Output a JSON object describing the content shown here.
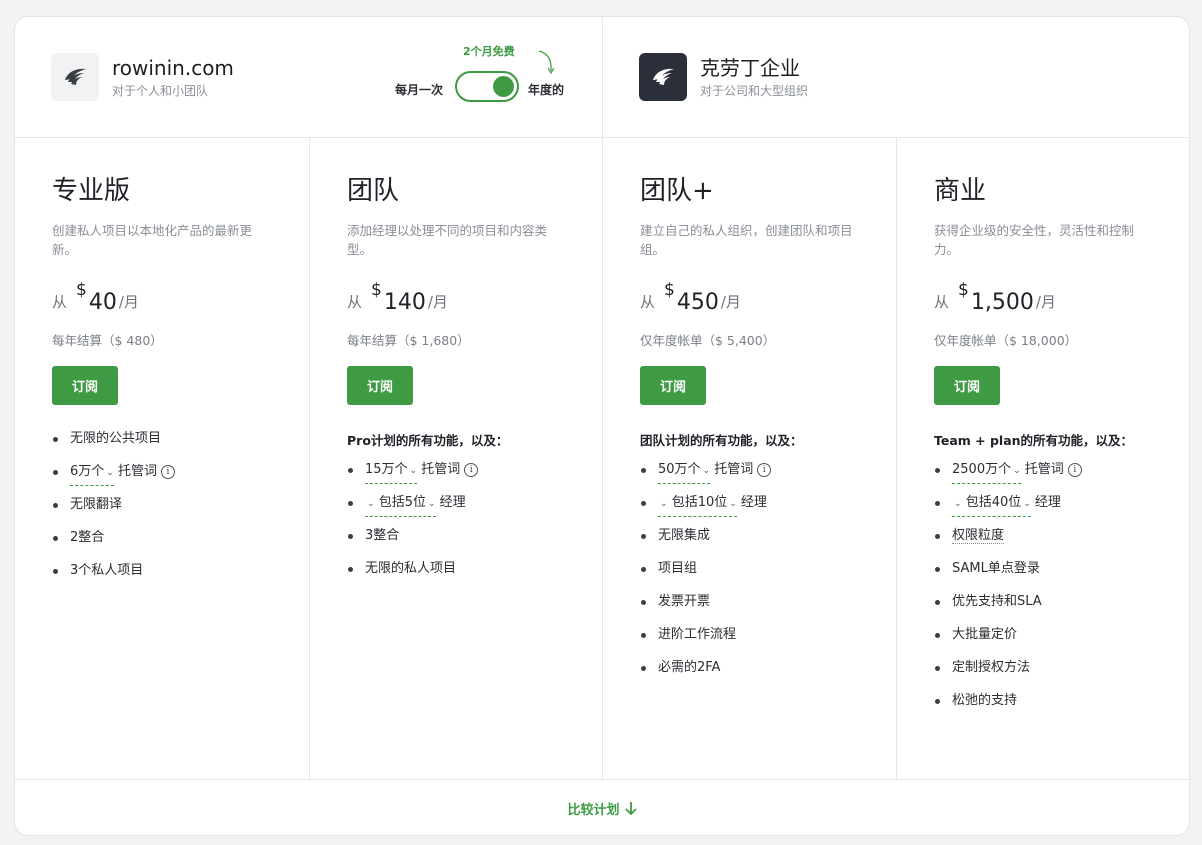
{
  "header": {
    "left_brand": {
      "name": "rowinin.com",
      "subtitle": "对于个人和小团队"
    },
    "right_brand": {
      "name": "克劳丁企业",
      "subtitle": "对于公司和大型组织"
    },
    "billing_toggle": {
      "promo": "2个月免费",
      "monthly_label": "每月一次",
      "annual_label": "年度的",
      "state": "annual"
    }
  },
  "plans": [
    {
      "name": "专业版",
      "description": "创建私人项目以本地化产品的最新更新。",
      "from": "从",
      "currency": "$",
      "amount": "40",
      "per": "/月",
      "billing": "每年结算（$ 480）",
      "button": "订阅",
      "features_heading": "",
      "features": [
        "无限的公共项目",
        "6万个",
        "托管词",
        "无限翻译",
        "2整合",
        "3个私人项目"
      ]
    },
    {
      "name": "团队",
      "description": "添加经理以处理不同的项目和内容类型。",
      "from": "从",
      "currency": "$",
      "amount": "140",
      "per": "/月",
      "billing": "每年结算（$ 1,680）",
      "button": "订阅",
      "features_heading": "Pro计划的所有功能，以及：",
      "features": [
        "15万个",
        "托管词",
        "包括5位",
        "经理",
        "3整合",
        "无限的私人项目"
      ]
    },
    {
      "name": "团队+",
      "description": "建立自己的私人组织，创建团队和项目组。",
      "from": "从",
      "currency": "$",
      "amount": "450",
      "per": "/月",
      "billing": "仅年度帐单（$ 5,400）",
      "button": "订阅",
      "features_heading": "团队计划的所有功能，以及：",
      "features": [
        "50万个",
        "托管词",
        "包括10位",
        "经理",
        "无限集成",
        "项目组",
        "发票开票",
        "进阶工作流程",
        "必需的2FA"
      ]
    },
    {
      "name": "商业",
      "description": "获得企业级的安全性，灵活性和控制力。",
      "from": "从",
      "currency": "$",
      "amount": "1,500",
      "per": "/月",
      "billing": "仅年度帐单（$ 18,000）",
      "button": "订阅",
      "features_heading": "Team + plan的所有功能，以及：",
      "features": [
        "2500万个",
        "托管词",
        "包括40位",
        "经理",
        "权限粒度",
        "SAML单点登录",
        "优先支持和SLA",
        "大批量定价",
        "定制授权方法",
        "松弛的支持"
      ]
    }
  ],
  "footer": {
    "compare_label": "比较计划"
  },
  "colors": {
    "accent": "#3e9b44",
    "dark_logo": "#2b2f3a"
  }
}
